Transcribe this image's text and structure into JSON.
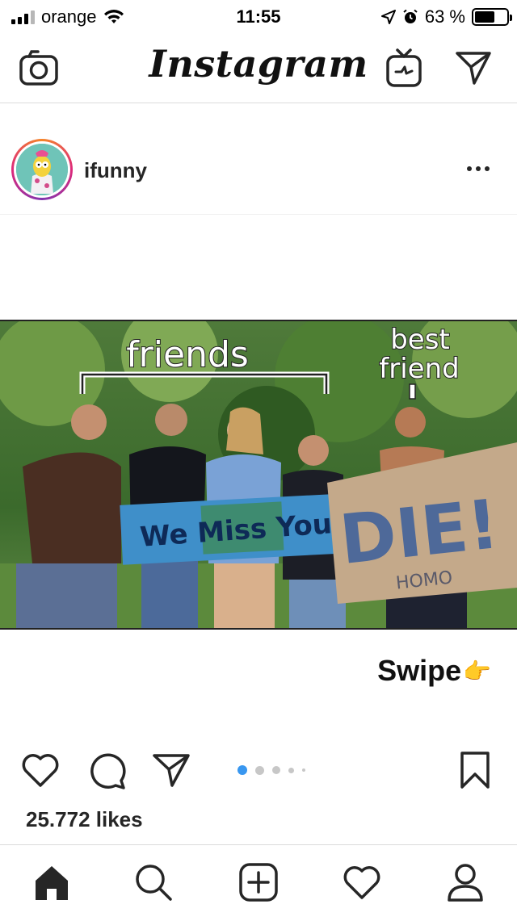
{
  "status_bar": {
    "carrier": "orange",
    "time": "11:55",
    "battery_text": "63 %",
    "battery_level": 0.63
  },
  "top_nav": {
    "brand": "Instagram",
    "icons": [
      "camera-icon",
      "igtv-icon",
      "direct-message-icon"
    ]
  },
  "post": {
    "username": "ifunny",
    "media": {
      "label_friends": "friends",
      "label_best_friend_line1": "best",
      "label_best_friend_line2": "friend",
      "banner_text": "We Miss You!",
      "sign_text": "DIE!",
      "sign_subtext": "HOMO",
      "swipe_text": "Swipe",
      "swipe_emoji": "👉"
    },
    "carousel": {
      "count": 5,
      "active_index": 0
    },
    "likes": "25.772 likes"
  },
  "bottom_nav": {
    "tabs": [
      "home-icon",
      "search-icon",
      "new-post-icon",
      "activity-icon",
      "profile-icon"
    ]
  },
  "colors": {
    "accent_blue": "#3897f0",
    "text": "#262626",
    "divider": "#dbdbdb"
  }
}
